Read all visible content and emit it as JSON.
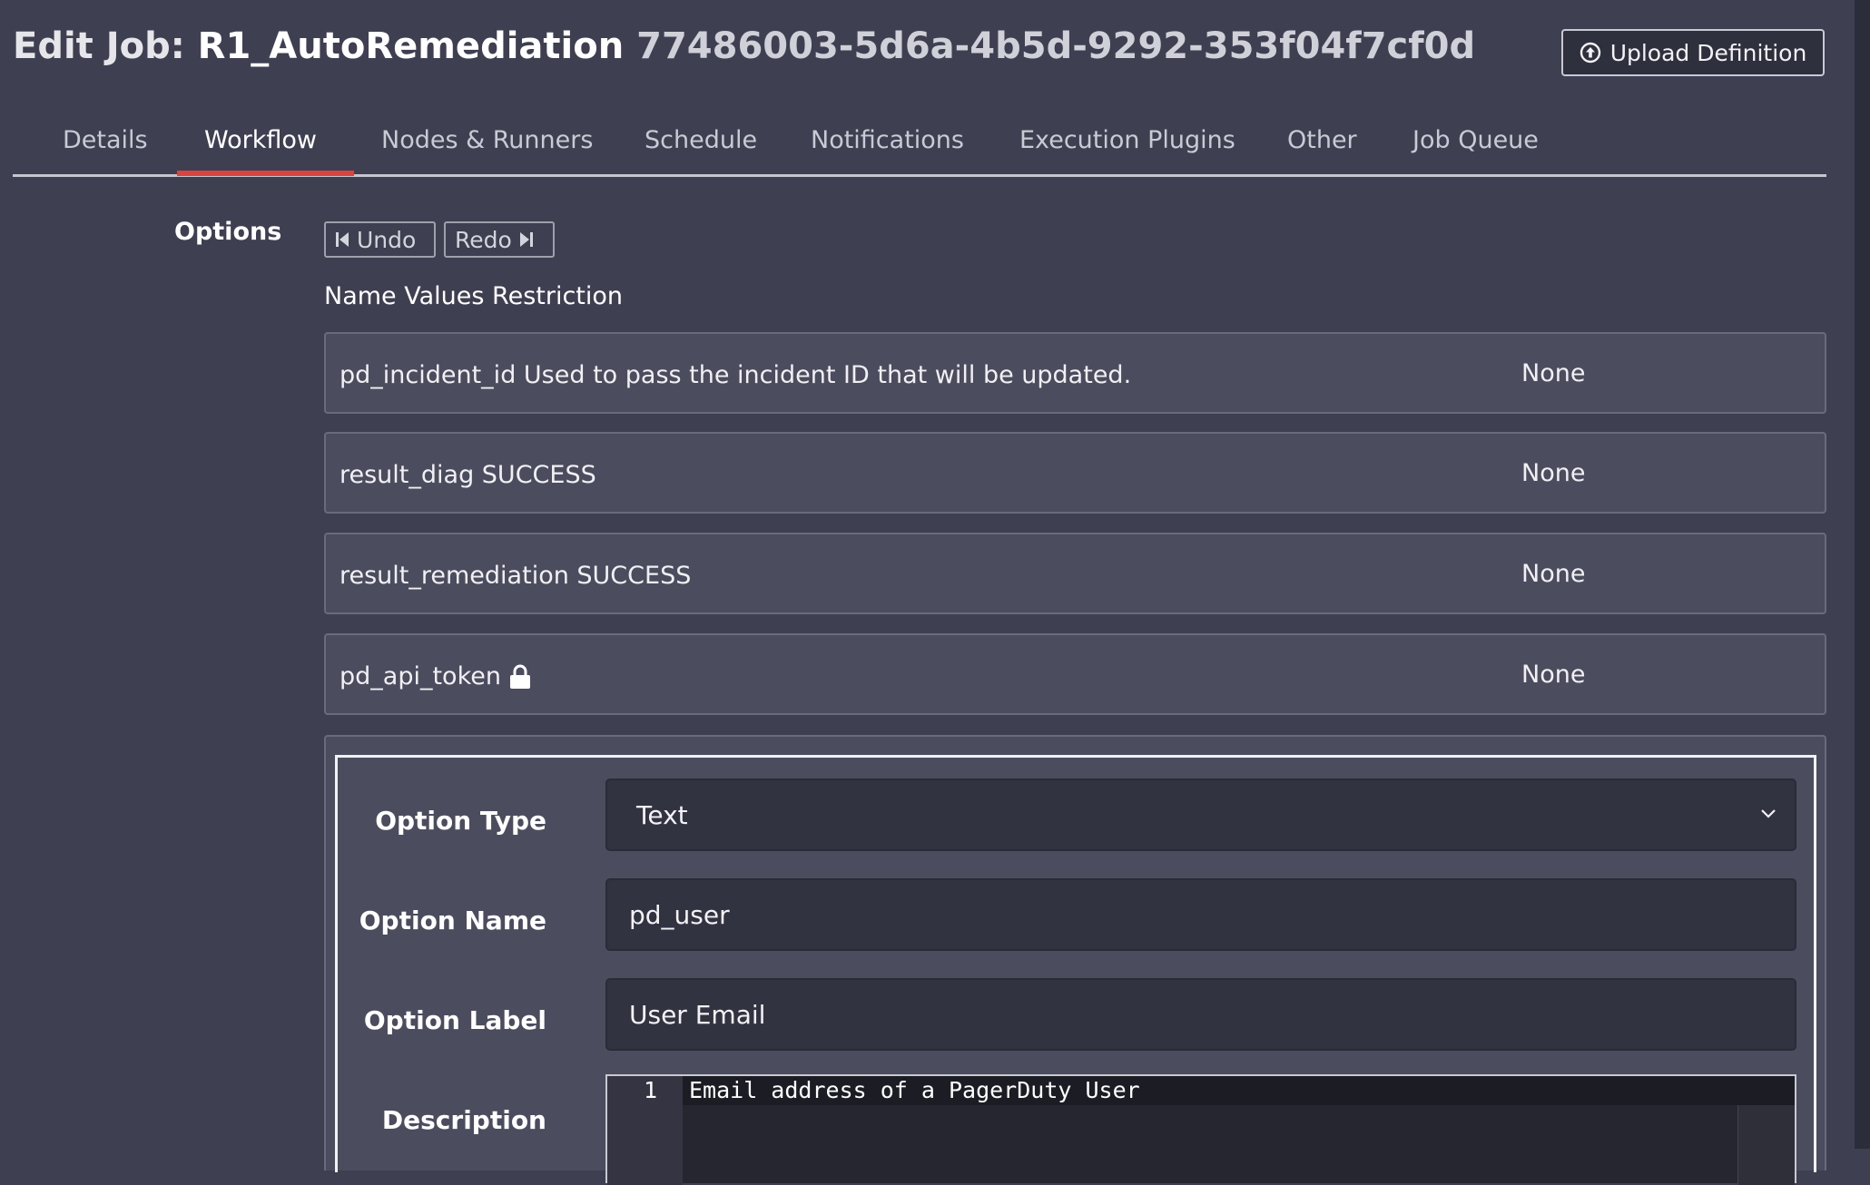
{
  "header": {
    "title_prefix": "Edit Job:",
    "job_name": "R1_AutoRemediation",
    "job_id": "77486003-5d6a-4b5d-9292-353f04f7cf0d",
    "upload_button": "Upload Definition"
  },
  "tabs": [
    {
      "label": "Details"
    },
    {
      "label": "Workflow",
      "active": true
    },
    {
      "label": "Nodes & Runners"
    },
    {
      "label": "Schedule"
    },
    {
      "label": "Notifications"
    },
    {
      "label": "Execution Plugins"
    },
    {
      "label": "Other"
    },
    {
      "label": "Job Queue"
    }
  ],
  "options": {
    "section_label": "Options",
    "undo_label": "Undo",
    "redo_label": "Redo",
    "columns_header": "Name Values Restriction",
    "rows": [
      {
        "name": "pd_incident_id Used to pass the incident ID that will be updated.",
        "restriction": "None"
      },
      {
        "name": "result_diag SUCCESS",
        "restriction": "None"
      },
      {
        "name": "result_remediation SUCCESS",
        "restriction": "None"
      },
      {
        "name": "pd_api_token",
        "restriction": "None",
        "icon": "lock-icon"
      }
    ]
  },
  "editor": {
    "option_type_label": "Option Type",
    "option_type_value": "Text",
    "option_name_label": "Option Name",
    "option_name_value": "pd_user",
    "option_label_label": "Option Label",
    "option_label_value": "User Email",
    "description_label": "Description",
    "description_line_number": "1",
    "description_text": "Email address of a PagerDuty User"
  },
  "colors": {
    "background": "#3e3f51",
    "tab_active_underline": "#d9453e"
  }
}
